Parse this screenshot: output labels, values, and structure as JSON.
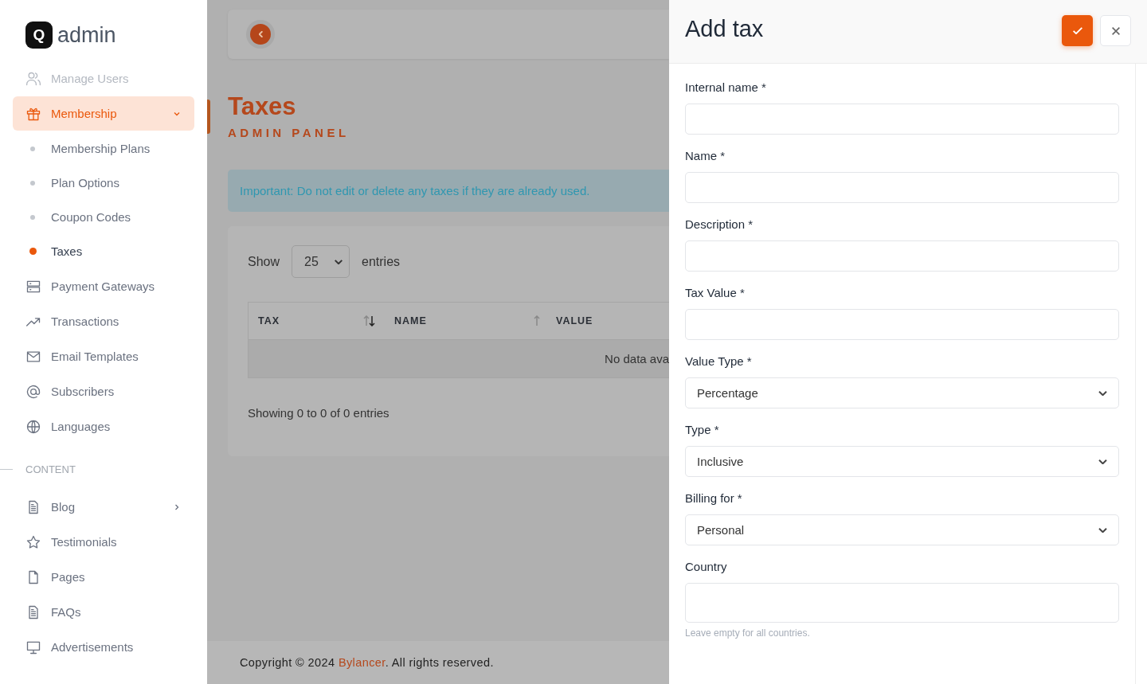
{
  "logo": {
    "mark": "Q",
    "text": "admin"
  },
  "sidebar": {
    "items": [
      {
        "kind": "item",
        "label": "Manage Users",
        "disabled": true,
        "selected": false
      },
      {
        "kind": "item",
        "label": "Membership",
        "disabled": false,
        "selected": true,
        "expanded": true
      },
      {
        "kind": "subitem",
        "label": "Membership Plans",
        "selected": false
      },
      {
        "kind": "subitem",
        "label": "Plan Options",
        "selected": false
      },
      {
        "kind": "subitem",
        "label": "Coupon Codes",
        "selected": false
      },
      {
        "kind": "subitem",
        "label": "Taxes",
        "selected": true
      },
      {
        "kind": "item",
        "label": "Payment Gateways",
        "disabled": false,
        "selected": false
      },
      {
        "kind": "item",
        "label": "Transactions",
        "disabled": false,
        "selected": false
      },
      {
        "kind": "item",
        "label": "Email Templates",
        "disabled": false,
        "selected": false
      },
      {
        "kind": "item",
        "label": "Subscribers",
        "disabled": false,
        "selected": false
      },
      {
        "kind": "item",
        "label": "Languages",
        "disabled": false,
        "selected": false
      },
      {
        "kind": "section",
        "label": "CONTENT"
      },
      {
        "kind": "item",
        "label": "Blog",
        "disabled": false,
        "selected": false,
        "expanded": false
      },
      {
        "kind": "item",
        "label": "Testimonials",
        "disabled": false,
        "selected": false
      },
      {
        "kind": "item",
        "label": "Pages",
        "disabled": false,
        "selected": false
      },
      {
        "kind": "item",
        "label": "FAQs",
        "disabled": false,
        "selected": false
      },
      {
        "kind": "item",
        "label": "Advertisements",
        "disabled": false,
        "selected": false
      }
    ]
  },
  "page": {
    "title": "Taxes",
    "subtitle": "ADMIN PANEL",
    "alert": "Important: Do not edit or delete any taxes if they are already used."
  },
  "table": {
    "show_label": "Show",
    "page_size": "25",
    "entries_label": "entries",
    "columns": [
      {
        "label": "TAX",
        "kind": "sorted"
      },
      {
        "label": "NAME",
        "kind": "sortable"
      },
      {
        "label": "VALUE",
        "kind": "plain"
      }
    ],
    "empty_text": "No data ava",
    "info": "Showing 0 to 0 of 0 entries"
  },
  "footer": {
    "before": "Copyright © 2024 ",
    "link": "Bylancer",
    "after": ". All rights reserved."
  },
  "drawer": {
    "title": "Add tax",
    "fields": [
      {
        "kind": "text",
        "label": "Internal name *"
      },
      {
        "kind": "text",
        "label": "Name *"
      },
      {
        "kind": "text",
        "label": "Description *"
      },
      {
        "kind": "text",
        "label": "Tax Value *"
      },
      {
        "kind": "select",
        "label": "Value Type *",
        "value": "Percentage"
      },
      {
        "kind": "select",
        "label": "Type *",
        "value": "Inclusive"
      },
      {
        "kind": "select",
        "label": "Billing for *",
        "value": "Personal"
      },
      {
        "kind": "tags",
        "label": "Country",
        "help": "Leave empty for all countries."
      }
    ]
  }
}
